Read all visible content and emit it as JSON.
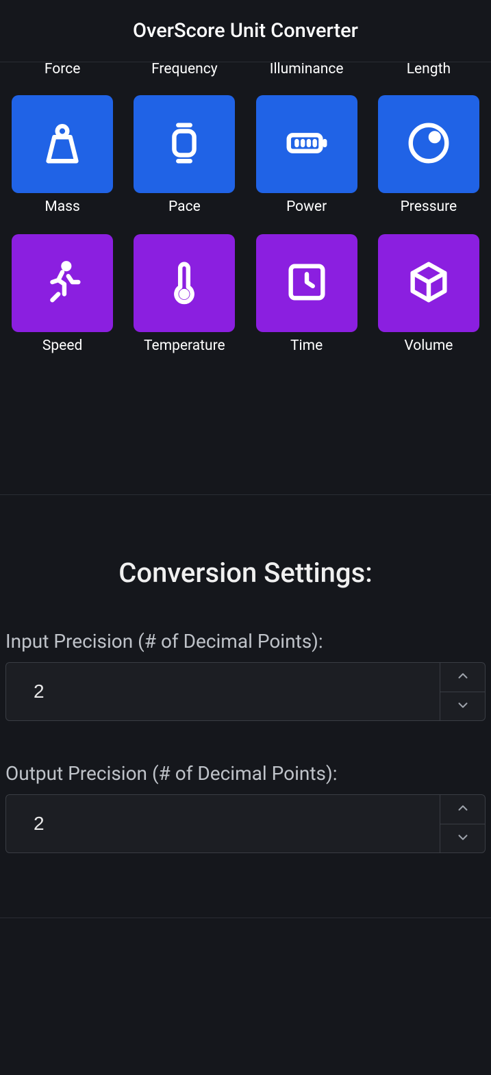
{
  "header": {
    "title": "OverScore Unit Converter"
  },
  "grid": {
    "row0": [
      {
        "label": "Force"
      },
      {
        "label": "Frequency"
      },
      {
        "label": "Illuminance"
      },
      {
        "label": "Length"
      }
    ],
    "row1": [
      {
        "label": "Mass",
        "color": "blue"
      },
      {
        "label": "Pace",
        "color": "blue"
      },
      {
        "label": "Power",
        "color": "blue"
      },
      {
        "label": "Pressure",
        "color": "blue"
      }
    ],
    "row2": [
      {
        "label": "Speed",
        "color": "purple"
      },
      {
        "label": "Temperature",
        "color": "purple"
      },
      {
        "label": "Time",
        "color": "purple"
      },
      {
        "label": "Volume",
        "color": "purple"
      }
    ]
  },
  "settings": {
    "title": "Conversion Settings:",
    "input_precision": {
      "label": "Input Precision (# of Decimal Points):",
      "value": "2"
    },
    "output_precision": {
      "label": "Output Precision (# of Decimal Points):",
      "value": "2"
    }
  }
}
